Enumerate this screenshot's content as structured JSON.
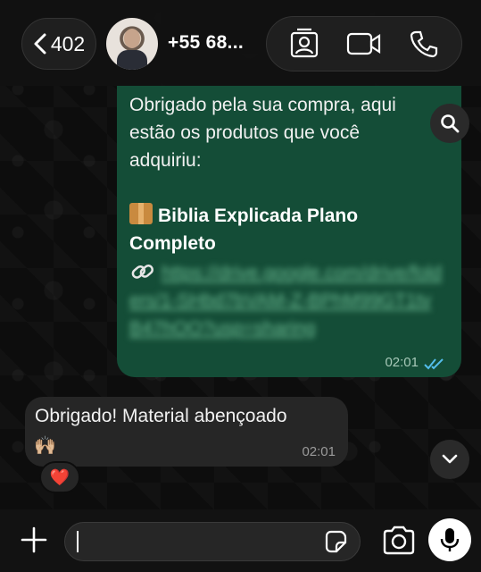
{
  "header": {
    "back_count": "402",
    "contact_name": "+55 68...",
    "icons": [
      "chevron-left-icon",
      "contact-card-icon",
      "video-camera-icon",
      "phone-icon"
    ]
  },
  "messages": {
    "outgoing": {
      "text": "Obrigado pela sua compra, aqui estão os produtos que você adquiriu:",
      "product_emoji": "package-icon",
      "product": "Biblia Explicada Plano Completo",
      "link_icon": "link-icon",
      "link_blurred": "https://drive.google.com/drive/folders/1-SHbd7bVAM-Z-BPhM99GT1tvB47hOO?usp=sharing",
      "time": "02:01",
      "status": "read"
    },
    "incoming": {
      "text": "Obrigado! Material abençoado",
      "emoji": "🙌🏼",
      "time": "02:01",
      "reaction": "❤️"
    }
  },
  "composer": {
    "input_value": "",
    "placeholder": "",
    "icons": [
      "plus-icon",
      "sticker-icon",
      "camera-icon",
      "microphone-icon"
    ]
  },
  "colors": {
    "outgoing_bubble": "#144d37",
    "incoming_bubble": "#262626",
    "read_ticks": "#53bdeb"
  }
}
